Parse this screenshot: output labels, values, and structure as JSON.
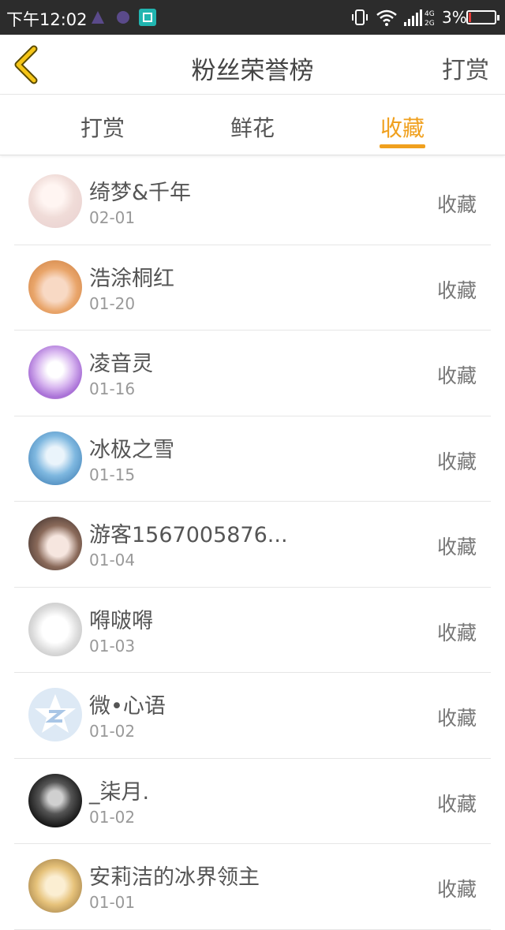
{
  "status_bar": {
    "time": "下午12:02",
    "network": "4G 2G",
    "battery": "3%"
  },
  "header": {
    "title": "粉丝荣誉榜",
    "right_action": "打赏"
  },
  "tabs": [
    {
      "label": "打赏"
    },
    {
      "label": "鲜花"
    },
    {
      "label": "收藏",
      "active": true
    }
  ],
  "fans": [
    {
      "name": "绮梦&千年",
      "date": "02-01",
      "action": "收藏"
    },
    {
      "name": "浩涂桐红",
      "date": "01-20",
      "action": "收藏"
    },
    {
      "name": "凌音灵",
      "date": "01-16",
      "action": "收藏"
    },
    {
      "name": "冰极之雪",
      "date": "01-15",
      "action": "收藏"
    },
    {
      "name": "游客1567005876...",
      "date": "01-04",
      "action": "收藏"
    },
    {
      "name": "嘚啵嘚",
      "date": "01-03",
      "action": "收藏"
    },
    {
      "name": "微•心语",
      "date": "01-02",
      "action": "收藏"
    },
    {
      "name": "_柒月.",
      "date": "01-02",
      "action": "收藏"
    },
    {
      "name": "安莉洁的冰界领主",
      "date": "01-01",
      "action": "收藏"
    }
  ],
  "colors": {
    "accent": "#f0a01e",
    "statusbar_bg": "#2c2c2c"
  }
}
